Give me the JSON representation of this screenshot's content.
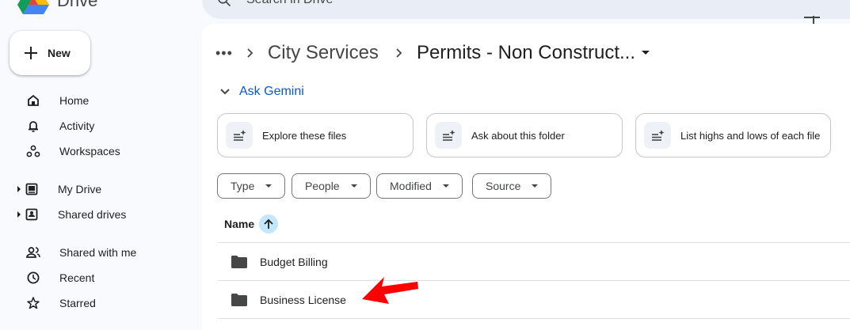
{
  "app": {
    "name": "Drive",
    "search_placeholder": "Search in Drive"
  },
  "sidebar": {
    "new_label": "New",
    "items": [
      {
        "label": "Home",
        "icon": "home-icon"
      },
      {
        "label": "Activity",
        "icon": "bell-icon"
      },
      {
        "label": "Workspaces",
        "icon": "workspaces-icon"
      },
      {
        "label": "My Drive",
        "icon": "my-drive-icon"
      },
      {
        "label": "Shared drives",
        "icon": "shared-drives-icon"
      },
      {
        "label": "Shared with me",
        "icon": "people-icon"
      },
      {
        "label": "Recent",
        "icon": "clock-icon"
      },
      {
        "label": "Starred",
        "icon": "star-icon"
      }
    ]
  },
  "breadcrumb": {
    "more": "•••",
    "parent": "City Services",
    "current": "Permits - Non Construct..."
  },
  "gemini": {
    "label": "Ask Gemini",
    "chips": [
      {
        "label": "Explore these files"
      },
      {
        "label": "Ask about this folder"
      },
      {
        "label": "List highs and lows of each file"
      }
    ]
  },
  "filters": [
    {
      "label": "Type"
    },
    {
      "label": "People"
    },
    {
      "label": "Modified"
    },
    {
      "label": "Source"
    }
  ],
  "table": {
    "name_header": "Name",
    "rows": [
      {
        "name": "Budget Billing",
        "icon": "folder-icon"
      },
      {
        "name": "Business License",
        "icon": "folder-icon"
      }
    ]
  },
  "colors": {
    "accent": "#0b57d0",
    "annotation_arrow": "#ff0000"
  }
}
